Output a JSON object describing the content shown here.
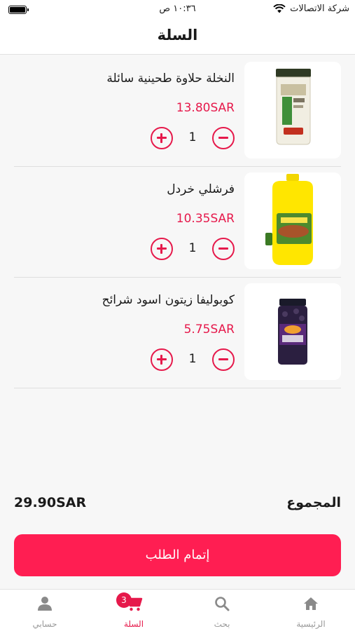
{
  "status_bar": {
    "carrier": "شركة الاتصالات",
    "time": "١٠:٣٦ ص"
  },
  "header": {
    "title": "السلة"
  },
  "items": [
    {
      "name": "النخلة حلاوة طحينية سائلة",
      "price": "13.80SAR",
      "quantity": "1"
    },
    {
      "name": "فرشلي خردل",
      "price": "10.35SAR",
      "quantity": "1"
    },
    {
      "name": "كوبوليفا زيتون اسود شرائح",
      "price": "5.75SAR",
      "quantity": "1"
    }
  ],
  "summary": {
    "total_label": "المجموع",
    "total_value": "29.90SAR"
  },
  "checkout": {
    "label": "إتمام الطلب"
  },
  "tabbar": {
    "home": "الرئيسية",
    "search": "بحث",
    "cart": "السلة",
    "cart_count": "3",
    "account": "حسابي"
  },
  "colors": {
    "accent": "#e6194b",
    "button": "#ff1e52"
  }
}
